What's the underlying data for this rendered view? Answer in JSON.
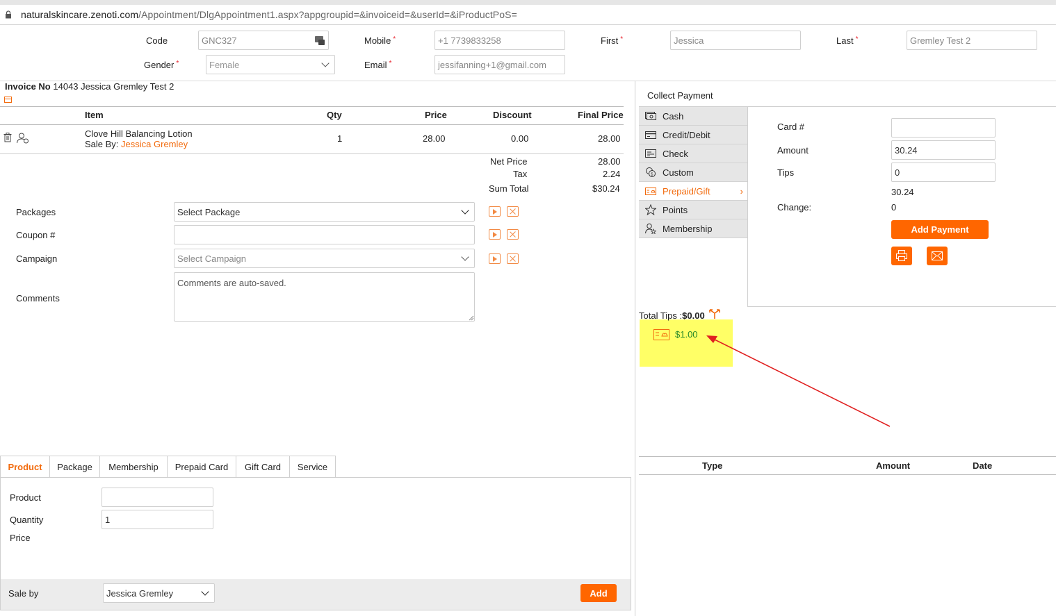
{
  "browser": {
    "url_host": "naturalskincare.zenoti.com",
    "url_path": "/Appointment/DlgAppointment1.aspx?appgroupid=&invoiceid=&userId=&iProductPoS="
  },
  "customer": {
    "code_label": "Code",
    "code_value": "GNC327",
    "mobile_label": "Mobile",
    "mobile_value": "+1 7739833258",
    "first_label": "First",
    "first_value": "Jessica",
    "last_label": "Last",
    "last_value": "Gremley Test 2",
    "gender_label": "Gender",
    "gender_value": "Female",
    "email_label": "Email",
    "email_value": "jessifanning+1@gmail.com",
    "required_mark": "*"
  },
  "invoice": {
    "label": "Invoice No",
    "number": "14043",
    "name": "Jessica Gremley Test 2",
    "columns": {
      "item": "Item",
      "qty": "Qty",
      "price": "Price",
      "discount": "Discount",
      "final": "Final Price"
    },
    "rows": [
      {
        "item": "Clove Hill Balancing Lotion",
        "sale_by_label": "Sale By:",
        "sale_by": "Jessica Gremley",
        "qty": "1",
        "price": "28.00",
        "discount": "0.00",
        "final": "28.00"
      }
    ],
    "totals": {
      "net_label": "Net Price",
      "net": "28.00",
      "tax_label": "Tax",
      "tax": "2.24",
      "sum_label": "Sum Total",
      "sum": "$30.24"
    }
  },
  "extras": {
    "packages_label": "Packages",
    "packages_value": "Select Package",
    "coupon_label": "Coupon #",
    "coupon_value": "",
    "campaign_label": "Campaign",
    "campaign_value": "Select Campaign",
    "comments_label": "Comments",
    "comments_placeholder": "Comments are auto-saved."
  },
  "payment": {
    "title": "Collect Payment",
    "methods": [
      "Cash",
      "Credit/Debit",
      "Check",
      "Custom",
      "Prepaid/Gift",
      "Points",
      "Membership"
    ],
    "active_method": "Prepaid/Gift",
    "card_label": "Card #",
    "card_value": "",
    "amount_label": "Amount",
    "amount_value": "30.24",
    "tips_label": "Tips",
    "tips_value": "0",
    "subtotal": "30.24",
    "change_label": "Change:",
    "change_value": "0",
    "add_payment": "Add Payment",
    "total_tips_label": "Total Tips :",
    "total_tips_value": "$0.00",
    "prepaid_balance": "$1.00",
    "history_columns": {
      "type": "Type",
      "amount": "Amount",
      "date": "Date"
    }
  },
  "bottom": {
    "tabs": [
      "Product",
      "Package",
      "Membership",
      "Prepaid Card",
      "Gift Card",
      "Service"
    ],
    "active_tab": "Product",
    "product_label": "Product",
    "product_value": "",
    "quantity_label": "Quantity",
    "quantity_value": "1",
    "price_label": "Price",
    "sale_by_label": "Sale by",
    "sale_by_value": "Jessica Gremley",
    "add_label": "Add"
  },
  "colors": {
    "accent": "#ff6600",
    "link_orange": "#f26a0c",
    "highlight": "#ffff66",
    "annotation_arrow": "#e02020"
  }
}
